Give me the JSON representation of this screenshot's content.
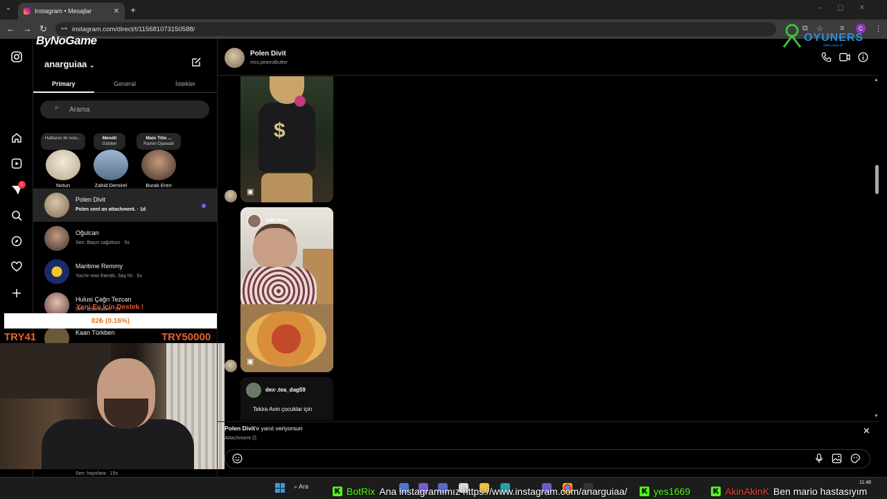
{
  "browser": {
    "tab_title": "Instagram • Mesajlar",
    "url": "instagram.com/direct/t/115681073150588/",
    "profile_initial": "C"
  },
  "overlays": {
    "bynogame": "ByNoGame",
    "oyuners_title": "OYUNERS",
    "oyuners_sub": "www.oyun.er",
    "donate_title": "Yeni Ev İçin Destek !",
    "donate_amount": "82₺ (0.16%)",
    "donate_current": "TRY41",
    "donate_goal": "TRY50000"
  },
  "sidebar": {
    "username": "anarguiaa",
    "tabs": [
      "Primary",
      "General",
      "İstekler"
    ],
    "search_placeholder": "Arama",
    "notification_count": "1"
  },
  "notes": [
    {
      "note": "Haftanın ilk notu...",
      "label": "Notun"
    },
    {
      "note_title": "Mendil",
      "note_sub": "Gülden",
      "label": "Zahid Demirel"
    },
    {
      "note_title": "Main Title ...",
      "note_sub": "Ramin Djawadi",
      "label": "Burak Eren"
    }
  ],
  "conversations": [
    {
      "name": "Polen Divit",
      "preview": "Polen sent an attachment. · 1d"
    },
    {
      "name": "Oğulcan",
      "preview": "Sen: Başın sağolsun · 5s"
    },
    {
      "name": "Maritime Remmy",
      "preview": "You're now friends. Say hi! · 5s"
    },
    {
      "name": "Hulusi Çağrı Tezcan",
      "preview": "Sen: anlamadım · 5s"
    },
    {
      "name": "Kaan Türkben",
      "preview": ""
    },
    {
      "name": "",
      "preview": "Sen: hayırlara · 15s"
    }
  ],
  "chat": {
    "name": "Polen Divit",
    "handle": "mss.peanutbutter",
    "reel2_handle": "labr.love",
    "reel3_handle": "dex·.tea_dag59",
    "reel3_caption": "Tekira Avm  çocuklar için",
    "reply_label_name": "Polen Divit",
    "reply_label_rest": "'e yanıt veriyorsun",
    "reply_attachment": "Attachment"
  },
  "taskbar": {
    "search": "Ara",
    "time": "11:48"
  },
  "ticker": [
    {
      "user": "BotRix",
      "msg": "Ana instagramımız https://www.instagram.com/anarguiaa/"
    },
    {
      "user": "yes1669",
      "msg": ""
    },
    {
      "user": "AkinAkinK",
      "msg": "Ben mario hastasıyım"
    }
  ],
  "icons": {
    "rail": [
      "instagram-icon",
      "home-icon",
      "reels-icon",
      "messages-icon",
      "search-icon",
      "explore-icon",
      "heart-icon",
      "plus-icon"
    ],
    "chat_header": [
      "phone-icon",
      "video-icon",
      "info-icon"
    ],
    "composer": [
      "emoji-icon",
      "mic-icon",
      "image-icon",
      "sticker-icon"
    ]
  },
  "colors": {
    "accent_unread": "#7166ff",
    "badge": "#ff3040",
    "kick_green": "#53fc18"
  }
}
